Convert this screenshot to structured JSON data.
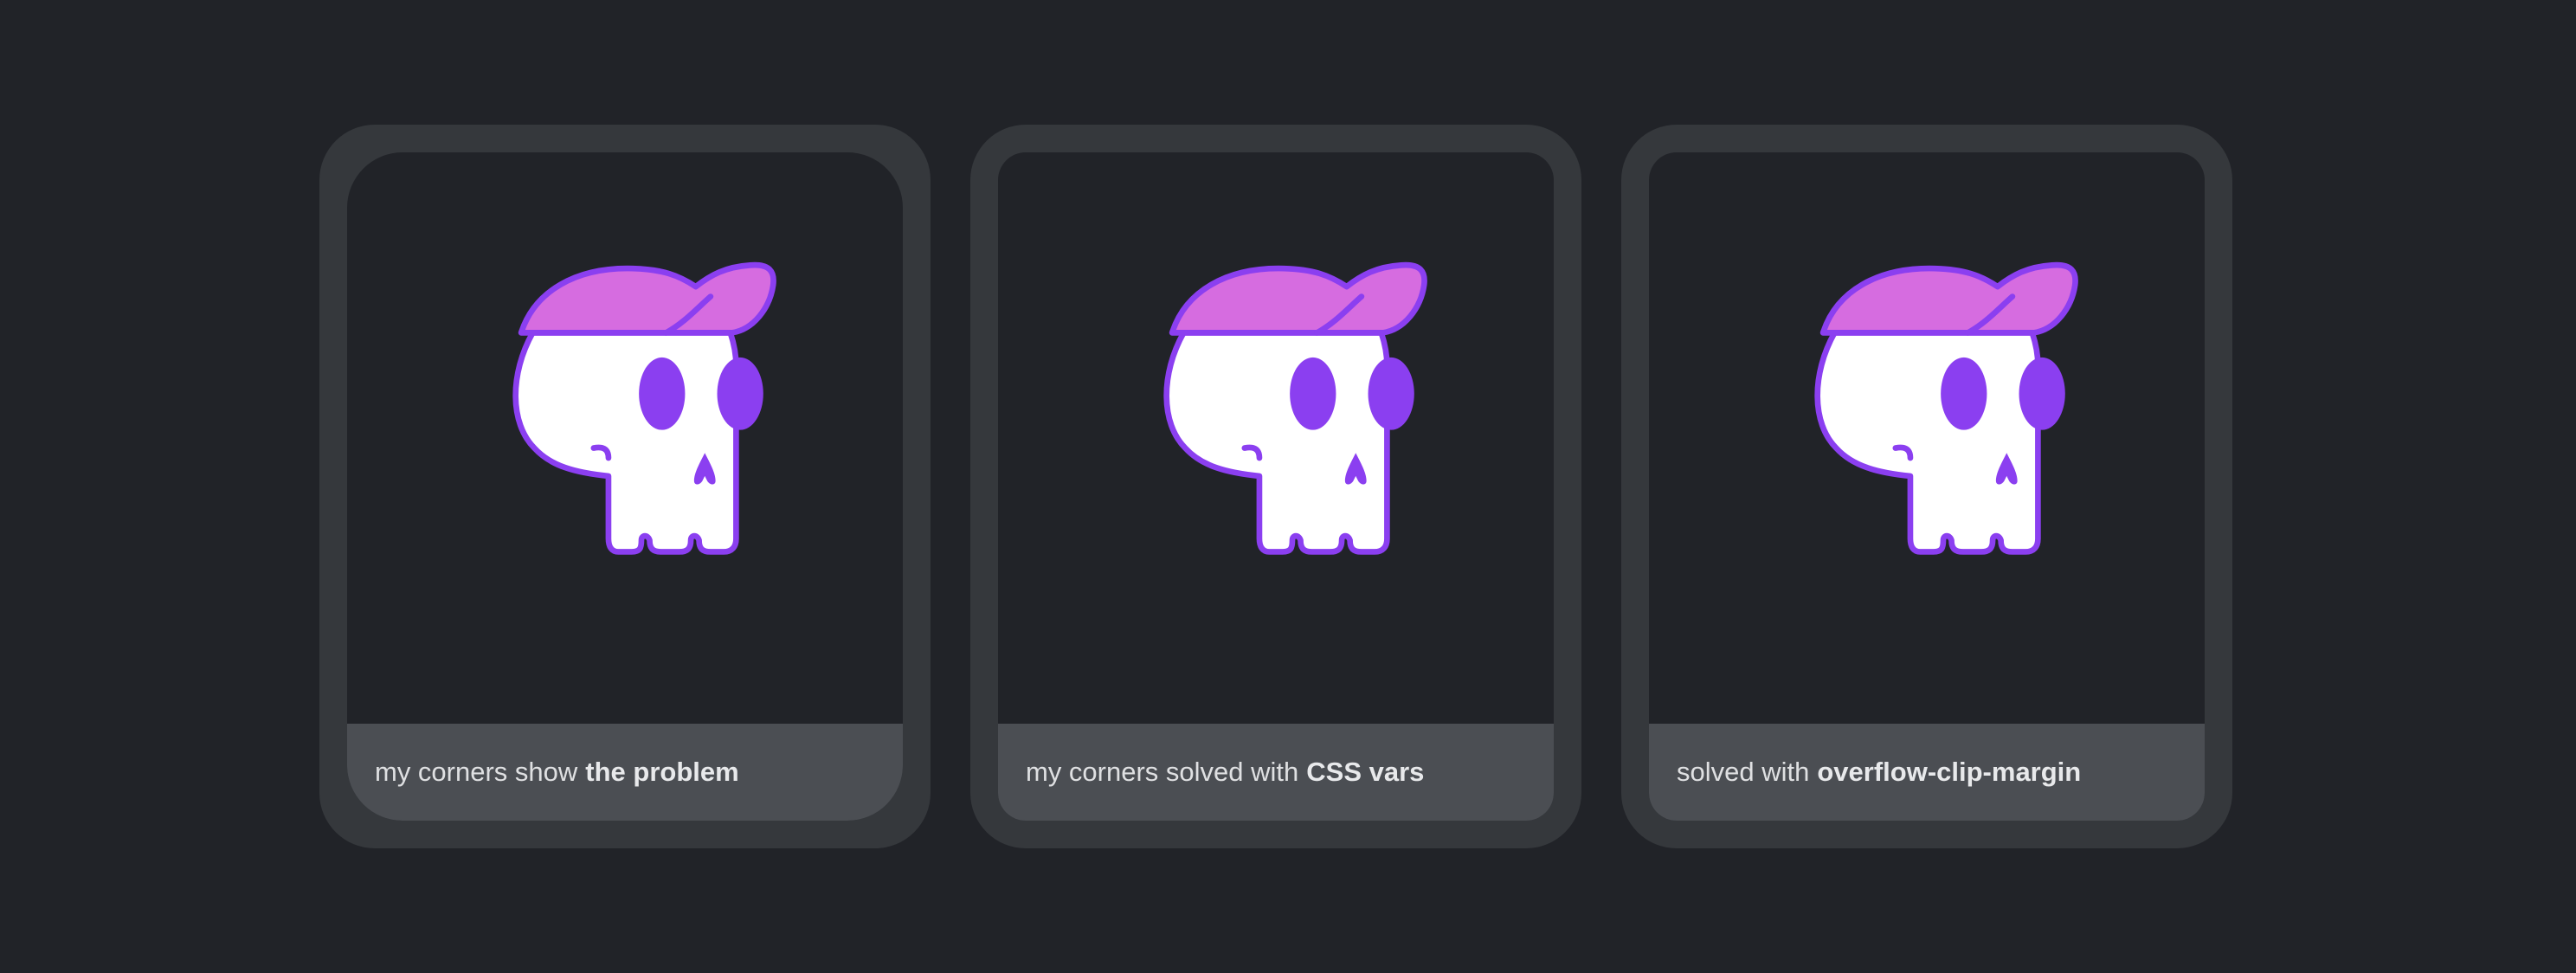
{
  "theme": {
    "background": "#212328",
    "card_frame": "#35383c",
    "caption_background": "#4b4e53",
    "skull_stroke": "#8b3ff0",
    "hat_fill": "#d66ce0",
    "skull_fill": "#ffffff"
  },
  "cards": [
    {
      "caption_text": "my corners show",
      "caption_emphasis": "the problem",
      "image_icon": "skull-with-cap-icon"
    },
    {
      "caption_text": "my corners solved with",
      "caption_emphasis": "CSS vars",
      "image_icon": "skull-with-cap-icon"
    },
    {
      "caption_text": "solved with",
      "caption_emphasis": "overflow-clip-margin",
      "image_icon": "skull-with-cap-icon"
    }
  ]
}
